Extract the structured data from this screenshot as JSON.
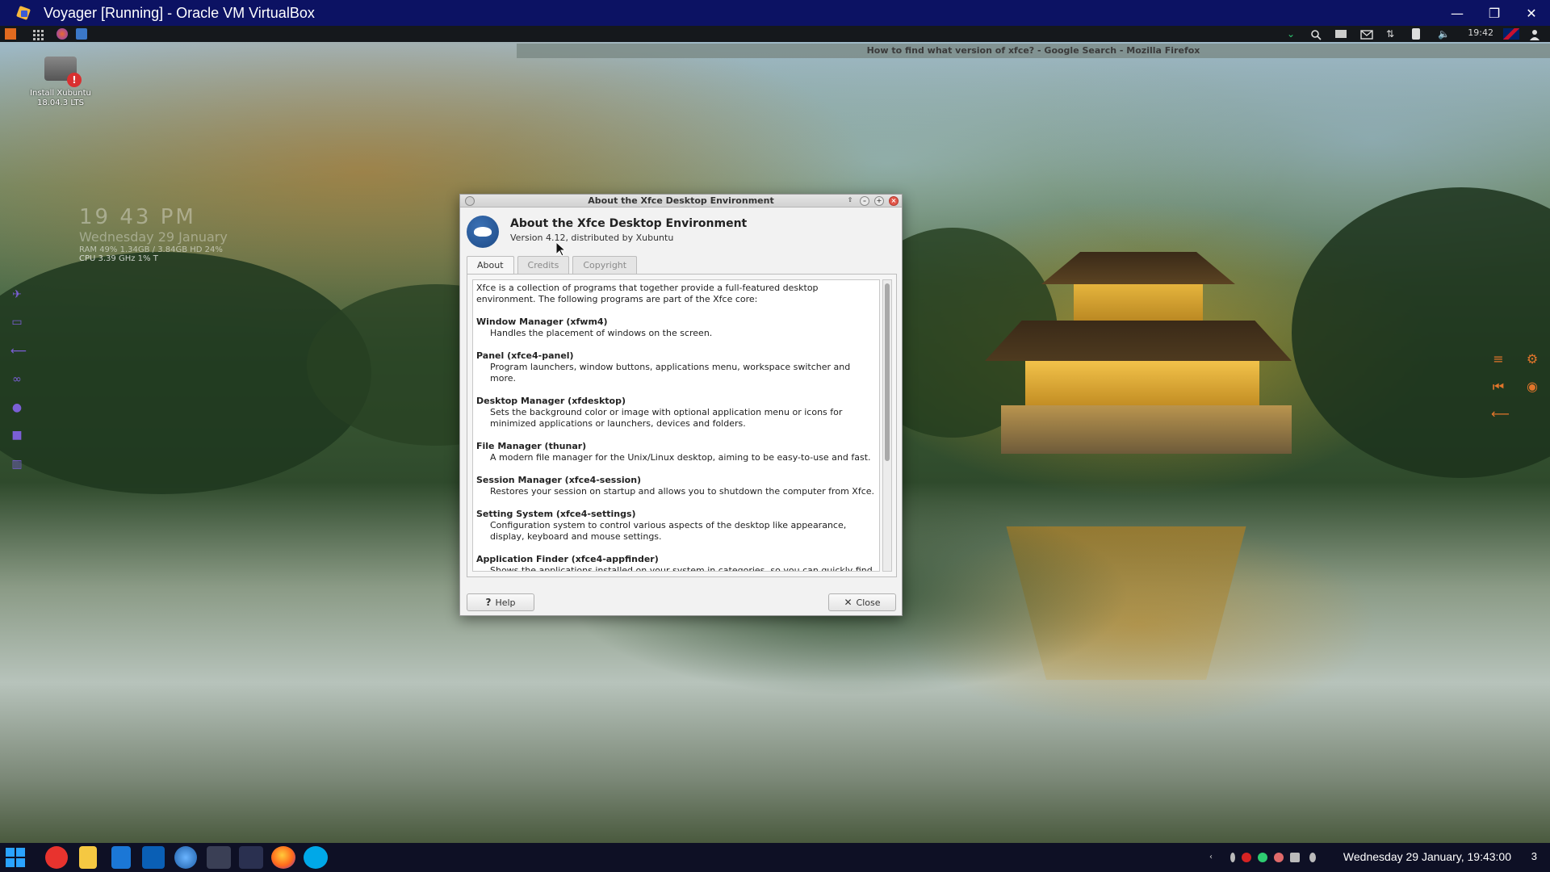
{
  "host_window": {
    "title": "Voyager [Running] - Oracle VM VirtualBox",
    "minimize": "—",
    "restore": "❐",
    "close": "✕"
  },
  "guest_panel": {
    "clock": "19:42"
  },
  "background_window": {
    "title": "How to find what version of xfce? - Google Search - Mozilla Firefox"
  },
  "desktop_icon": {
    "label": "Install Xubuntu 18.04.3 LTS"
  },
  "conky": {
    "time": "19 43 PM",
    "date": "Wednesday 29 January",
    "sys": "RAM 49% 1.34GB / 3.84GB  HD 24%",
    "cpu": "CPU 3.39 GHz 1% T"
  },
  "dialog": {
    "window_title": "About the Xfce Desktop Environment",
    "title": "About the Xfce Desktop Environment",
    "version": "Version 4.12, distributed by Xubuntu",
    "tabs": [
      {
        "label": "About"
      },
      {
        "label": "Credits"
      },
      {
        "label": "Copyright"
      }
    ],
    "intro": "Xfce is a collection of programs that together provide a full-featured desktop environment. The following programs are part of the Xfce core:",
    "sections": [
      {
        "title": "Window Manager (xfwm4)",
        "desc": "Handles the placement of windows on the screen."
      },
      {
        "title": "Panel (xfce4-panel)",
        "desc": "Program launchers, window buttons, applications menu, workspace switcher and more."
      },
      {
        "title": "Desktop Manager (xfdesktop)",
        "desc": "Sets the background color or image with optional application menu or icons for minimized applications or launchers, devices and folders."
      },
      {
        "title": "File Manager  (thunar)",
        "desc": "A modern file manager for the Unix/Linux desktop, aiming to be easy-to-use and fast."
      },
      {
        "title": "Session Manager (xfce4-session)",
        "desc": "Restores your session on startup and allows you to shutdown the computer from Xfce."
      },
      {
        "title": "Setting System (xfce4-settings)",
        "desc": "Configuration system to control various aspects of the desktop like appearance, display, keyboard and mouse settings."
      },
      {
        "title": "Application Finder (xfce4-appfinder)",
        "desc": "Shows the applications installed on your system in categories, so you can quickly find"
      }
    ],
    "help_label": "Help",
    "close_label": "Close"
  },
  "taskbar": {
    "datetime": "Wednesday 29 January, 19:43:00",
    "notifications": "3"
  },
  "colors": {
    "host_titlebar": "#0c1263",
    "close_button": "#e3574a",
    "accent_purple": "#7b5fd6",
    "accent_orange": "#e1752b"
  }
}
